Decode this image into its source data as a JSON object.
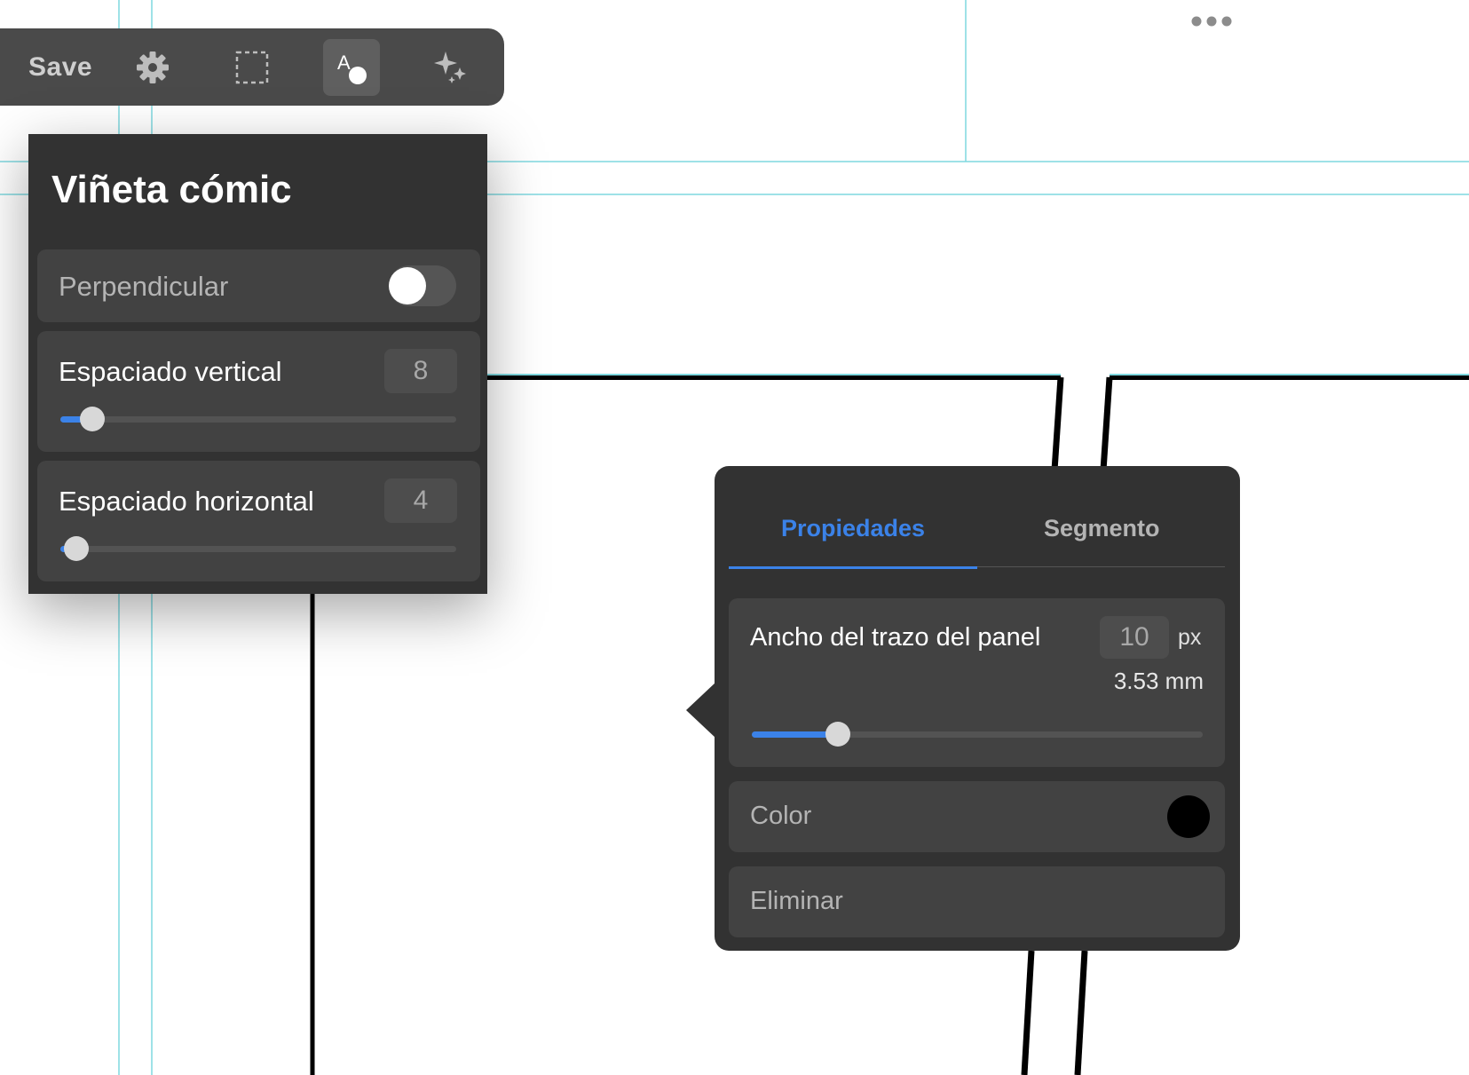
{
  "toolbar": {
    "save_label": "Save",
    "tools": [
      "gear-icon",
      "selection-icon",
      "text-shape-icon",
      "sparkle-icon"
    ],
    "active_tool": "text-shape-icon"
  },
  "overflow_menu": "more-icon",
  "comic_panel": {
    "title": "Viñeta cómic",
    "perpendicular": {
      "label": "Perpendicular",
      "enabled": false
    },
    "vertical_spacing": {
      "label": "Espaciado vertical",
      "value": "8",
      "slider_fraction": 0.08
    },
    "horizontal_spacing": {
      "label": "Espaciado horizontal",
      "value": "4",
      "slider_fraction": 0.04
    }
  },
  "properties_popover": {
    "tabs": [
      {
        "label": "Propiedades",
        "active": true
      },
      {
        "label": "Segmento",
        "active": false
      }
    ],
    "stroke_width": {
      "label": "Ancho del trazo del panel",
      "value": "10",
      "unit": "px",
      "mm": "3.53 mm",
      "slider_fraction": 0.19
    },
    "color": {
      "label": "Color",
      "value": "#000000"
    },
    "delete_label": "Eliminar"
  },
  "colors": {
    "accent": "#3b82e8",
    "guide": "#7fd8df",
    "panel_bg": "#323232",
    "row_bg": "#424242"
  }
}
